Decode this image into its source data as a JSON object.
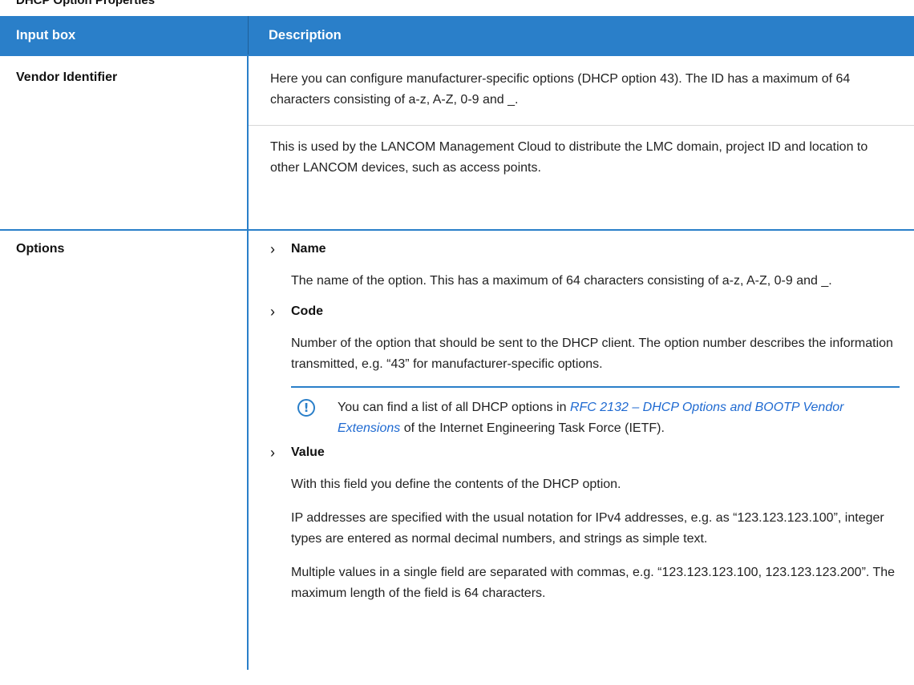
{
  "caption": "DHCP Option Properties",
  "table": {
    "header": {
      "col1": "Input box",
      "col2": "Description"
    },
    "rows": {
      "vendor": {
        "label": "Vendor Identifier",
        "p1": "Here you can configure manufacturer-specific options (DHCP option 43). The ID has a maximum of 64 characters consisting of a-z, A-Z, 0-9 and _.",
        "p2": "This is used by the LANCOM Management Cloud to distribute the LMC domain, project ID and location to other LANCOM devices, such as access points."
      },
      "options": {
        "label": "Options",
        "name_title": "Name",
        "name_desc": "The name of the option. This has a maximum of 64 characters consisting of a-z, A-Z, 0-9 and _.",
        "code_title": "Code",
        "code_desc": "Number of the option that should be sent to the DHCP client. The option number describes the information transmitted, e.g. “43” for manufacturer-specific options.",
        "note_pre": "You can find a list of all DHCP options in ",
        "note_link": "RFC 2132 – DHCP Options and BOOTP Vendor Extensions",
        "note_post": " of the Internet Engineering Task Force (IETF).",
        "value_title": "Value",
        "value_p1": "With this field you define the contents of the DHCP option.",
        "value_p2": "IP addresses are specified with the usual notation for IPv4 addresses, e.g. as “123.123.123.100”, integer types are entered as normal decimal numbers, and strings as simple text.",
        "value_p3": "Multiple values in a single field are separated with commas, e.g. “123.123.123.100, 123.123.123.200”. The maximum length of the field is 64 characters."
      }
    }
  },
  "icons": {
    "bullet": "chevron-right-icon",
    "note": "exclamation-circle-icon"
  },
  "colors": {
    "header_bg": "#2a7fc9",
    "link": "#1f6ad1"
  }
}
